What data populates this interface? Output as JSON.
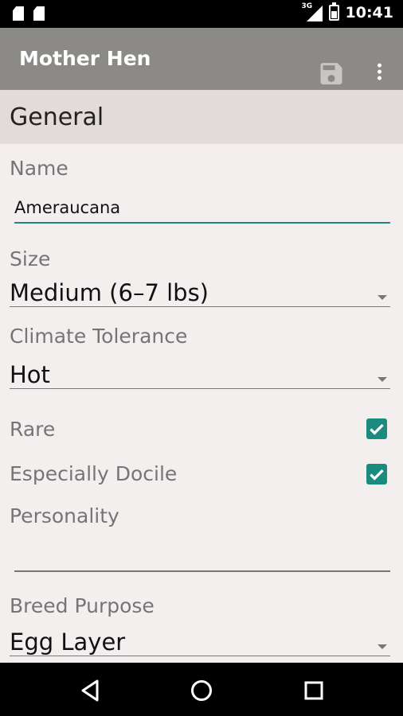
{
  "status_bar": {
    "network": "3G",
    "time": "10:41"
  },
  "app_bar": {
    "title": "Mother Hen",
    "save_icon": "save-icon",
    "more_icon": "more-vert-icon"
  },
  "form": {
    "section_title": "General",
    "name": {
      "label": "Name",
      "value": "Ameraucana"
    },
    "size": {
      "label": "Size",
      "value": "Medium (6–7 lbs)"
    },
    "climate": {
      "label": "Climate Tolerance",
      "value": "Hot"
    },
    "rare": {
      "label": "Rare",
      "checked": true
    },
    "docile": {
      "label": "Especially Docile",
      "checked": true
    },
    "personality": {
      "label": "Personality",
      "value": ""
    },
    "purpose": {
      "label": "Breed Purpose",
      "value": "Egg Layer"
    }
  },
  "colors": {
    "accent": "#1b8a7f",
    "appbar": "#8c8a86",
    "background": "#f4efef",
    "section_header": "#e3dada"
  },
  "nav_bar": {
    "back_icon": "back-icon",
    "home_icon": "home-icon",
    "recents_icon": "recents-icon"
  }
}
